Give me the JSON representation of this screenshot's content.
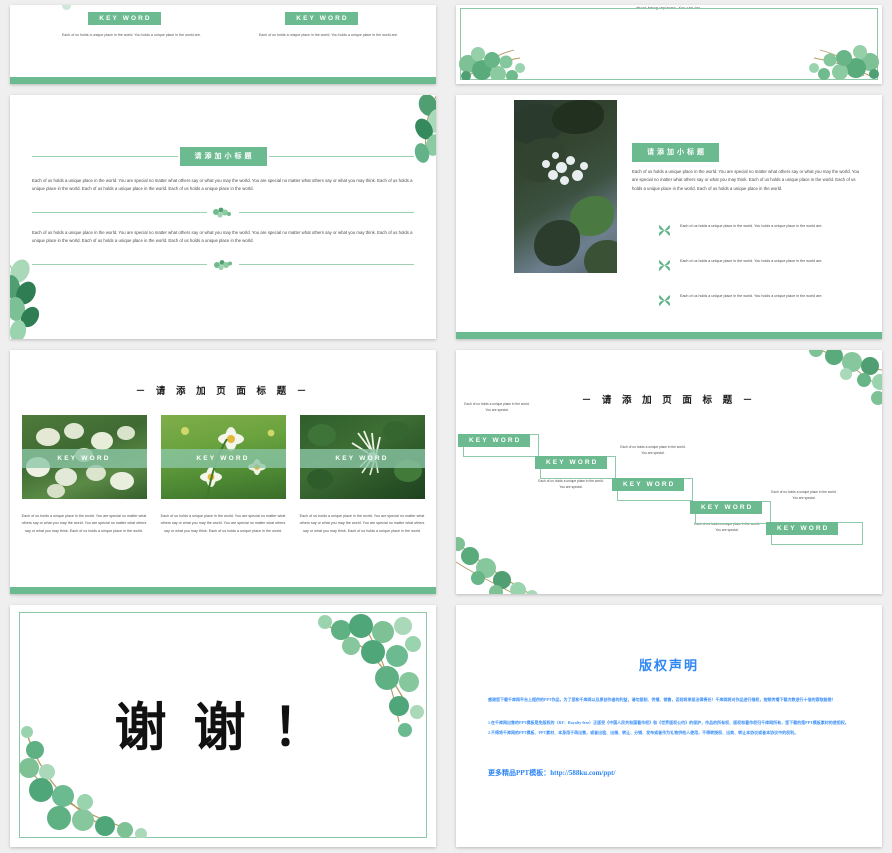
{
  "theme": {
    "accent_green": "#6cba90",
    "light_green": "#8cc7a6",
    "line_green": "#9fd0b3",
    "page_bg": "#efefef",
    "slide_bg": "#ffffff",
    "copyright_blue": "#2f86f5"
  },
  "common": {
    "key_word": "KEY WORD",
    "section_title": "请添加小标题",
    "page_title": "－ 请 添 加 页 面 标 题 －",
    "paragraph_long": "Each of us holds a unique place in the world.  You are special no matter what others say or what you may the world.  You are special no matter what others say or what you may think.  Each of us holds a unique place in the world.  Each of us holds a unique place in the world.  Each of us holds a unique place in the world.",
    "paragraph_short": "Each of us holds a unique place in the world.  You holds a unique place in the world are.",
    "caption_special": "Each of us holds a unique place in the world.  You are special."
  },
  "slides": [
    {
      "id": "slide-1",
      "name": "two-column-keyword-slide",
      "columns": [
        {
          "keyword": "KEY WORD",
          "text": "Each of us holds a unique place in the world.  You holds a unique place in the world are."
        },
        {
          "keyword": "KEY WORD",
          "text": "Each of us holds a unique place in the world.  You holds a unique place in the world are."
        }
      ]
    },
    {
      "id": "slide-2",
      "name": "framed-leaf-slide",
      "top_text": "about being replaced. You can  too."
    },
    {
      "id": "slide-3",
      "name": "subtitle-text-slide",
      "section_title": "请添加小标题",
      "paragraph_1": "Each of us holds a unique place in the world.  You are special no matter what others say or what you may the world.  You are special no matter what others say or what you may think.  Each of us holds a unique place in the world.  Each of us holds a unique place in the world.  Each of us holds a unique place in the world.",
      "paragraph_2": "Each of us holds a unique place in the world.  You are special no matter what others say or what you may the world.  You are special no matter what others say or what you may think.  Each of us holds a unique place in the world.  Each of us holds a unique place in the world.  Each of us holds a unique place in the world."
    },
    {
      "id": "slide-4",
      "name": "photo-and-bullets-slide",
      "section_title": "请添加小标题",
      "paragraph": "Each of us holds a unique place in the world.  You are special no matter what others say or what you may the world.  You are special no matter what others say or what you may think.  Each of us holds a unique place in the world.  Each of us holds a unique place in the world.  Each of us holds a unique place in the world.",
      "bullets": [
        "Each of us holds a unique place in the world.  You holds a unique place in the world are.",
        "Each of us holds a unique place in the world.  You holds a unique place in the world are.",
        "Each of us holds a unique place in the world.  You holds a unique place in the world are."
      ]
    },
    {
      "id": "slide-5",
      "name": "three-image-cards-slide",
      "page_title": "－ 请 添 加 页 面 标 题 －",
      "cards": [
        {
          "keyword": "KEY WORD",
          "text": "Each of us holds a unique place in the world.  You are special no matter what others say or what you may the world.  You are special no matter what others say or what you may think.  Each of us holds a unique place in the world."
        },
        {
          "keyword": "KEY WORD",
          "text": "Each of us holds a unique place in the world.  You are special no matter what others say or what you may the world.  You are special no matter what others say or what you may think.  Each of us holds a unique place in the world."
        },
        {
          "keyword": "KEY WORD",
          "text": "Each of us holds a unique place in the world.  You are special no matter what others say or what you may the world.  You are special no matter what others say or what you may think.  Each of us holds a unique place in the world."
        }
      ]
    },
    {
      "id": "slide-6",
      "name": "staircase-diagram-slide",
      "page_title": "－ 请 添 加 页 面 标 题 －",
      "steps": [
        {
          "keyword": "KEY WORD",
          "caption": "Each of us holds a unique place in the world.  You are special."
        },
        {
          "keyword": "KEY WORD",
          "caption": "Each of us holds a unique place in the world.  You are special."
        },
        {
          "keyword": "KEY WORD",
          "caption": "Each of us holds a unique place in the world.  You are special."
        },
        {
          "keyword": "KEY WORD",
          "caption": "Each of us holds a unique place in the world.  You are special."
        },
        {
          "keyword": "KEY WORD",
          "caption": "Each of us holds a unique place in the world.  You are special."
        }
      ]
    },
    {
      "id": "slide-7",
      "name": "thank-you-slide",
      "thanks": "谢 谢 ！"
    },
    {
      "id": "slide-8",
      "name": "copyright-slide",
      "title": "版权声明",
      "intro": "感谢您下载千库网平台上提供的PPT作品，为了您和千库网以及原创作者的利益，请勿复制、传播、销售，否则将承担法律责任！千库网将对作品进行维权，按照传播下载次数进行十倍的索取赔偿！",
      "clause_1": "1.在千库网出售的PPT模板是免版权的（RF：Royalty-free）正版受《中国人民共和国著作权》和《世界版权公约》的保护，作品的所有权、版权和著作权归千库网所有，您下载的是PPT模板素材的使用权。",
      "clause_2": "2.不得将千库网的PPT模板、PPT素材、本身用于再出售，或者出租、出借、转让、分销、发布或者作为礼物供他人使用，不得转授权、出卖、转让本协议或者本协议中的权利。",
      "link_label": "更多精品PPT模板：",
      "link_url": "http://588ku.com/ppt/"
    }
  ]
}
